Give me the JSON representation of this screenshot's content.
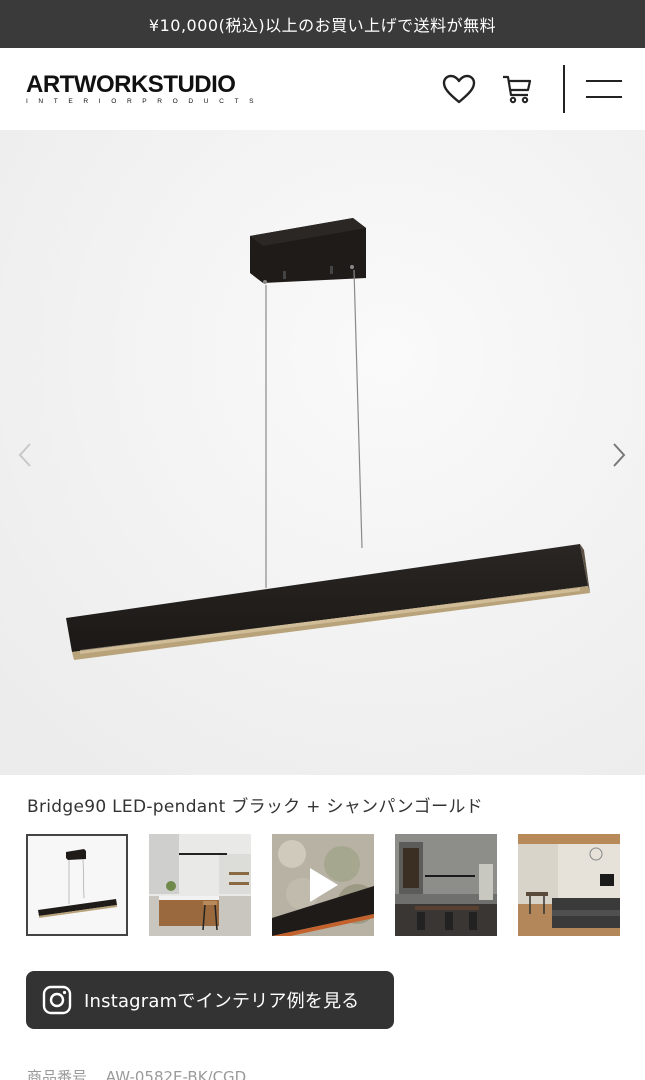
{
  "promo": {
    "text": "¥10,000(税込)以上のお買い上げで送料が無料"
  },
  "header": {
    "logo_main": "ARTWORKSTUDIO",
    "logo_sub": "INTERIORPRODUCTS",
    "icons": {
      "favorite": "heart-icon",
      "cart": "cart-icon",
      "menu": "hamburger-menu-icon"
    }
  },
  "gallery": {
    "nav": {
      "prev": "chevron-left-icon",
      "next": "chevron-right-icon"
    }
  },
  "product": {
    "title": "Bridge90 LED-pendant ブラック + シャンパンゴールド",
    "sku_label": "商品番号",
    "sku_value": "AW-0582E-BK/CGD"
  },
  "thumbnails": [
    {
      "kind": "product-photo",
      "active": true
    },
    {
      "kind": "kitchen-photo",
      "active": false
    },
    {
      "kind": "video",
      "active": false
    },
    {
      "kind": "dining-photo",
      "active": false
    },
    {
      "kind": "living-photo",
      "active": false
    }
  ],
  "instagram_button": {
    "label": "Instagramでインテリア例を見る",
    "icon": "instagram-icon"
  },
  "colors": {
    "dark": "#333333",
    "promo_bg": "#3a3a3a",
    "gallery_bg": "#f3f3f3",
    "gold": "#b8a27a"
  }
}
